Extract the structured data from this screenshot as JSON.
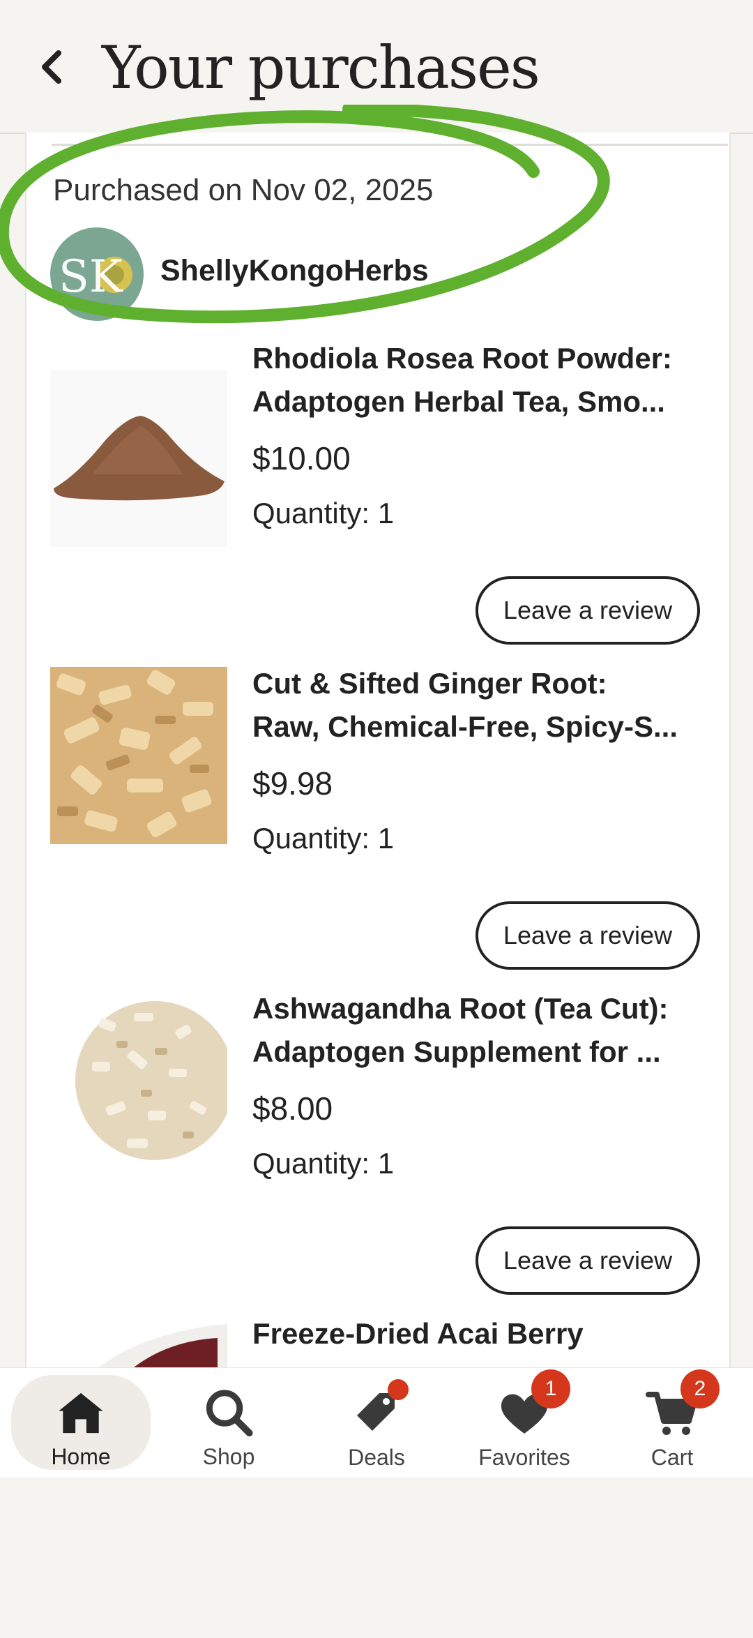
{
  "header": {
    "title": "Your purchases"
  },
  "order": {
    "purchased_on": "Purchased on Nov 02, 2025",
    "shop": {
      "name": "ShellyKongoHerbs",
      "avatar_text": "SK"
    }
  },
  "items": [
    {
      "title_line1": "Rhodiola Rosea Root Powder:",
      "title_line2": "Adaptogen Herbal Tea, Smo...",
      "price": "$10.00",
      "quantity": "Quantity: 1",
      "review_label": "Leave a review"
    },
    {
      "title_line1": "Cut & Sifted Ginger Root:",
      "title_line2": "Raw, Chemical-Free, Spicy-S...",
      "price": "$9.98",
      "quantity": "Quantity: 1",
      "review_label": "Leave a review"
    },
    {
      "title_line1": "Ashwagandha Root (Tea Cut):",
      "title_line2": "Adaptogen Supplement for ...",
      "price": "$8.00",
      "quantity": "Quantity: 1",
      "review_label": "Leave a review"
    },
    {
      "title_line1": "Freeze-Dried Acai Berry"
    }
  ],
  "nav": {
    "home": "Home",
    "shop": "Shop",
    "deals": "Deals",
    "favorites": "Favorites",
    "favorites_badge": "1",
    "cart": "Cart",
    "cart_badge": "2"
  },
  "colors": {
    "highlight": "#5fb02f",
    "badge": "#d4371c",
    "icon": "#3a3a3a"
  }
}
